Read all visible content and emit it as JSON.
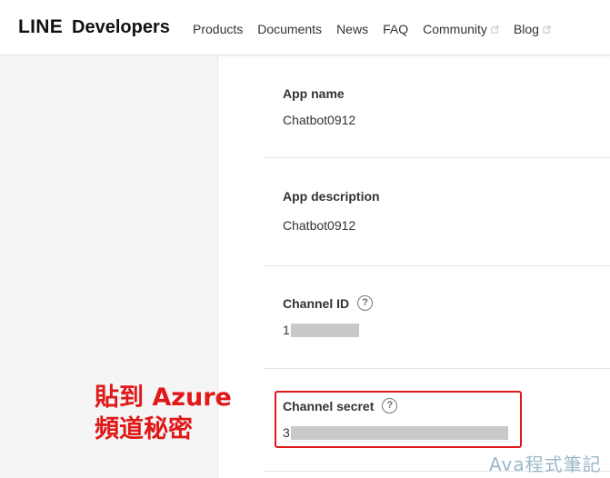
{
  "header": {
    "logo_line": "LINE",
    "logo_developers": "Developers",
    "nav": [
      {
        "label": "Products",
        "external": false
      },
      {
        "label": "Documents",
        "external": false
      },
      {
        "label": "News",
        "external": false
      },
      {
        "label": "FAQ",
        "external": false
      },
      {
        "label": "Community",
        "external": true
      },
      {
        "label": "Blog",
        "external": true
      }
    ]
  },
  "fields": {
    "app_name": {
      "label": "App name",
      "value": "Chatbot0912"
    },
    "app_description": {
      "label": "App description",
      "value": "Chatbot0912"
    },
    "channel_id": {
      "label": "Channel ID",
      "value_prefix": "1",
      "help": "?"
    },
    "channel_secret": {
      "label": "Channel secret",
      "value_prefix": "3",
      "help": "?"
    }
  },
  "annotation": {
    "line1": "貼到 Azure",
    "line2": "頻道秘密"
  },
  "watermark": "Ava程式筆記",
  "colors": {
    "annotation_red": "#e01818",
    "mask_gray": "#c9c9c9",
    "sidebar_bg": "#f5f5f5"
  }
}
